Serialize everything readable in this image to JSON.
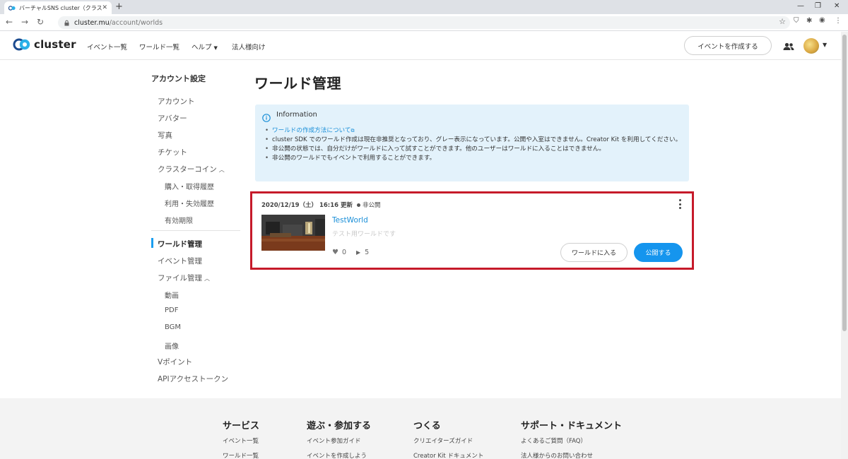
{
  "browser": {
    "tab_title": "バーチャルSNS cluster（クラスター）",
    "url_host": "cluster.mu",
    "url_path": "/account/worlds"
  },
  "header": {
    "logo_text": "cluster",
    "nav": [
      "イベント一覧",
      "ワールド一覧",
      "ヘルプ",
      "法人様向け"
    ],
    "create_event_label": "イベントを作成する"
  },
  "sidebar": {
    "title": "アカウント設定",
    "items": [
      "アカウント",
      "アバター",
      "写真",
      "チケット",
      "クラスターコイン"
    ],
    "coin_sub": [
      "購入・取得履歴",
      "利用・失効履歴",
      "有効期限"
    ],
    "world_mgmt": "ワールド管理",
    "event_mgmt": "イベント管理",
    "file_mgmt": "ファイル管理",
    "file_sub": [
      "動画",
      "PDF",
      "BGM",
      "画像"
    ],
    "vpoint": "Vポイント",
    "api_token": "APIアクセストークン"
  },
  "main": {
    "title": "ワールド管理",
    "info": {
      "heading": "Information",
      "link_text": "ワールドの作成方法について",
      "lines": [
        "cluster SDK でのワールド作成は現在非推奨となっており、グレー表示になっています。公開や入室はできません。Creator Kit を利用してください。",
        "非公開の状態では、自分だけがワールドに入って試すことができます。他のユーザーはワールドに入ることはできません。",
        "非公開のワールドでもイベントで利用することができます。"
      ]
    },
    "world": {
      "date": "2020/12/19（土） 16:16 更新",
      "status": "非公開",
      "name": "TestWorld",
      "description": "テスト用ワールドです",
      "likes": "0",
      "plays": "5",
      "enter_label": "ワールドに入る",
      "publish_label": "公開する"
    }
  },
  "footer": {
    "columns": [
      {
        "title": "サービス",
        "links": [
          "イベント一覧",
          "ワールド一覧"
        ]
      },
      {
        "title": "遊ぶ・参加する",
        "links": [
          "イベント参加ガイド",
          "イベントを作成しよう"
        ]
      },
      {
        "title": "つくる",
        "links": [
          "クリエイターズガイド",
          "Creator Kit ドキュメント"
        ]
      },
      {
        "title": "サポート・ドキュメント",
        "links": [
          "よくあるご質問（FAQ）",
          "法人様からのお問い合わせ"
        ]
      }
    ]
  },
  "colors": {
    "accent": "#1595ee",
    "highlight_border": "#c61a2a",
    "info_bg": "#e3f2fb"
  }
}
